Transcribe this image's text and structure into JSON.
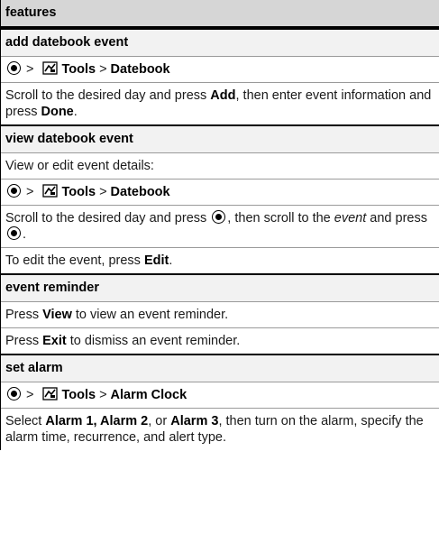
{
  "header": {
    "title": "features"
  },
  "sections": {
    "add_event": {
      "title": "add datebook event",
      "path": {
        "menu": "Tools",
        "sep": ">",
        "item": "Datebook"
      },
      "desc": {
        "p1": "Scroll to the desired day and press ",
        "k1": "Add",
        "p2": ", then enter event information and press ",
        "k2": "Done",
        "p3": "."
      }
    },
    "view_event": {
      "title": "view datebook event",
      "intro": "View or edit event details:",
      "path": {
        "menu": "Tools",
        "sep": ">",
        "item": "Datebook"
      },
      "desc": {
        "p1": "Scroll to the desired day and press ",
        "p2": ", then scroll to the ",
        "em": "event",
        "p3": " and press ",
        "p4": "."
      },
      "edit": {
        "p1": "To edit the event, press ",
        "k1": "Edit",
        "p2": "."
      }
    },
    "reminder": {
      "title": "event reminder",
      "view": {
        "p1": "Press ",
        "k1": "View",
        "p2": " to view an event reminder."
      },
      "exit": {
        "p1": "Press ",
        "k1": "Exit",
        "p2": " to dismiss an event reminder."
      }
    },
    "alarm": {
      "title": "set alarm",
      "path": {
        "menu": "Tools",
        "sep": ">",
        "item": "Alarm Clock"
      },
      "desc": {
        "p1": "Select ",
        "k1": "Alarm 1, Alarm 2",
        "p2": ", or ",
        "k2": "Alarm 3",
        "p3": ", then turn on the alarm, specify the alarm time, recurrence, and alert type."
      }
    }
  },
  "icons": [
    "center-select-icon",
    "tools-menu-icon"
  ]
}
